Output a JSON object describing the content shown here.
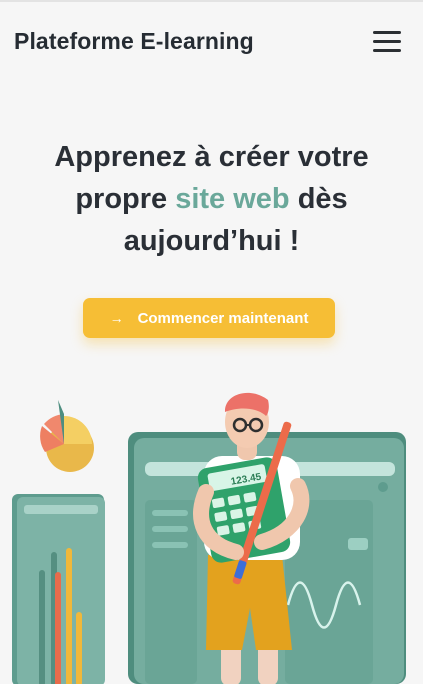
{
  "navbar": {
    "brand": "Plateforme E-learning",
    "menu_icon": "hamburger-menu-icon"
  },
  "hero": {
    "title_part1": "Apprenez à créer votre",
    "title_part2_pre": "propre ",
    "title_highlight": "site web",
    "title_part2_post": " dès",
    "title_part3": "aujourd’hui !",
    "highlight_color": "#6aa89a"
  },
  "cta": {
    "label": "Commencer maintenant",
    "icon": "arrow-right-icon",
    "color": "#f6be35"
  },
  "illustration": {
    "name": "learner-with-laptop-illustration",
    "calculator_display": "123.45"
  },
  "colors": {
    "background": "#f6f6f6",
    "text": "#262c33",
    "teal": "#6aa89a"
  }
}
